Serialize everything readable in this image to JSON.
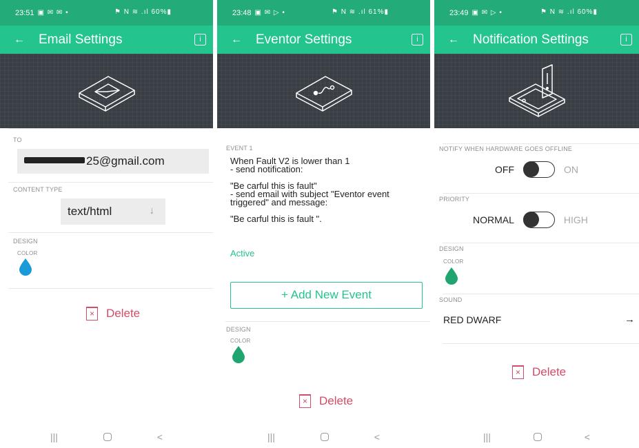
{
  "colors": {
    "accent": "#23c48e",
    "statusbar": "#23ac79",
    "danger": "#d24c66",
    "hero_bg": "#3a3f46",
    "drop_blue": "#1a9bd7",
    "drop_green": "#20a570"
  },
  "panels": [
    {
      "status": {
        "time": "23:51",
        "left_icons": "▣ ✉ ✉ •",
        "right_icons": "⚑ N ≋ .ıl 60%▮"
      },
      "title": "Email Settings",
      "hero_icon": "email-device-icon",
      "to_label": "TO",
      "to_value": "25@gmail.com",
      "content_type_label": "CONTENT TYPE",
      "content_type_value": "text/html",
      "design_label": "DESIGN",
      "color_label": "COLOR",
      "delete_label": "Delete"
    },
    {
      "status": {
        "time": "23:48",
        "left_icons": "▣ ✉ ▷ •",
        "right_icons": "⚑ N ≋ .ıl 61%▮"
      },
      "title": "Eventor Settings",
      "hero_icon": "eventor-device-icon",
      "event_label": "EVENT 1",
      "event_lines": [
        "When Fault V2 is lower than 1",
        "- send notification:",
        "",
        "\"Be carful this is fault\"",
        "- send email with subject \"Eventor event triggered\" and message:",
        "",
        "\"Be carful this is fault \"."
      ],
      "active_label": "Active",
      "add_event_label": "+ Add New Event",
      "design_label": "DESIGN",
      "color_label": "COLOR",
      "delete_label": "Delete"
    },
    {
      "status": {
        "time": "23:49",
        "left_icons": "▣ ✉ ▷ •",
        "right_icons": "⚑ N ≋ .ıl 60%▮"
      },
      "title": "Notification Settings",
      "hero_icon": "phone-notification-icon",
      "notify_label": "NOTIFY WHEN HARDWARE GOES OFFLINE",
      "notify_off": "OFF",
      "notify_on": "ON",
      "priority_label": "PRIORITY",
      "priority_normal": "NORMAL",
      "priority_high": "HIGH",
      "design_label": "DESIGN",
      "color_label": "COLOR",
      "sound_label": "SOUND",
      "sound_value": "RED DWARF",
      "delete_label": "Delete"
    }
  ],
  "navbar": {
    "recent": "|||",
    "back": "<"
  }
}
